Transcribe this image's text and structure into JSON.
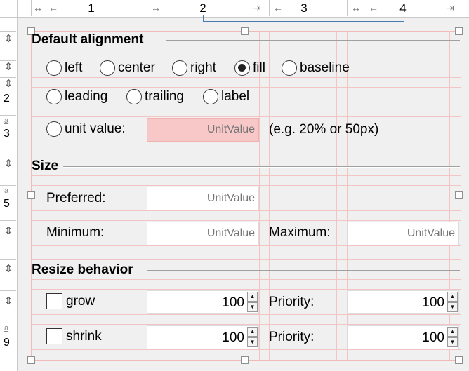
{
  "ruler": {
    "columns": [
      "1",
      "2",
      "3",
      "4"
    ],
    "rows": [
      "2",
      "3",
      "5",
      "9"
    ]
  },
  "sections": {
    "default_alignment": "Default alignment",
    "size": "Size",
    "resize": "Resize behavior"
  },
  "alignment": {
    "options_row1": [
      "left",
      "center",
      "right",
      "fill",
      "baseline"
    ],
    "options_row2": [
      "leading",
      "trailing",
      "label"
    ],
    "selected": "fill",
    "unit_label": "unit value:",
    "unit_placeholder": "UnitValue",
    "unit_hint": "(e.g. 20% or 50px)"
  },
  "size": {
    "preferred_label": "Preferred:",
    "preferred_placeholder": "UnitValue",
    "minimum_label": "Minimum:",
    "minimum_placeholder": "UnitValue",
    "maximum_label": "Maximum:",
    "maximum_placeholder": "UnitValue"
  },
  "resize": {
    "grow_label": "grow",
    "grow_checked": false,
    "grow_value": "100",
    "grow_priority_label": "Priority:",
    "grow_priority_value": "100",
    "shrink_label": "shrink",
    "shrink_checked": false,
    "shrink_value": "100",
    "shrink_priority_label": "Priority:",
    "shrink_priority_value": "100"
  },
  "colors": {
    "guide": "#f3c4c4",
    "error_field": "#f8c8c8",
    "ruler_bracket": "#4a78b5"
  }
}
